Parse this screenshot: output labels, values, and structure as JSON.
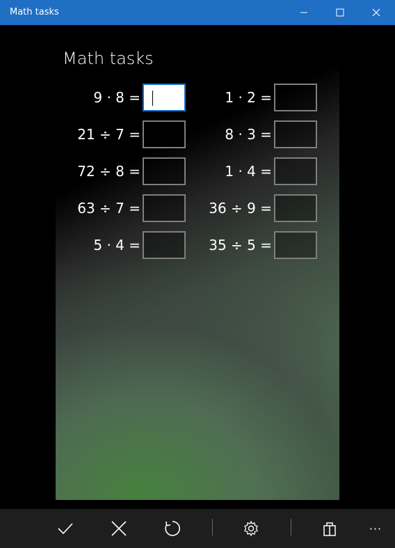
{
  "window": {
    "title": "Math tasks"
  },
  "app": {
    "heading": "Math tasks"
  },
  "tasks_left": [
    {
      "expr": "9 · 8 =",
      "value": ""
    },
    {
      "expr": "21 ÷ 7 =",
      "value": ""
    },
    {
      "expr": "72 ÷ 8 =",
      "value": ""
    },
    {
      "expr": "63 ÷ 7 =",
      "value": ""
    },
    {
      "expr": "5 · 4 =",
      "value": ""
    }
  ],
  "tasks_right": [
    {
      "expr": "1 · 2 =",
      "value": ""
    },
    {
      "expr": "8 · 3 =",
      "value": ""
    },
    {
      "expr": "1 · 4 =",
      "value": ""
    },
    {
      "expr": "36 ÷ 9 =",
      "value": ""
    },
    {
      "expr": "35 ÷ 5 =",
      "value": ""
    }
  ],
  "commandbar": {
    "items": [
      "check-icon",
      "close-icon",
      "refresh-icon",
      "settings-icon",
      "store-icon",
      "more-icon"
    ],
    "more_label": "···"
  },
  "colors": {
    "titlebar": "#1f6fc5",
    "commandbar": "#1e1e1e",
    "input_border": "#7f7f7f"
  }
}
